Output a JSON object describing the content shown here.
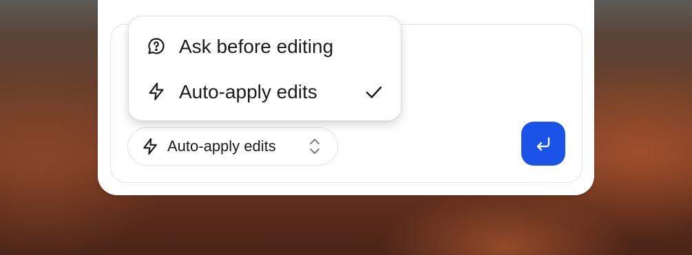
{
  "menu": {
    "items": [
      {
        "label": "Ask before editing",
        "icon": "chat-question-icon",
        "selected": false
      },
      {
        "label": "Auto-apply edits",
        "icon": "lightning-bolt-icon",
        "selected": true
      }
    ]
  },
  "mode_selector": {
    "label": "Auto-apply edits",
    "icon": "lightning-bolt-icon",
    "chevron": "chevron-up-down-icon"
  },
  "send_button": {
    "icon": "enter-return-icon",
    "color": "#1a53e8"
  }
}
